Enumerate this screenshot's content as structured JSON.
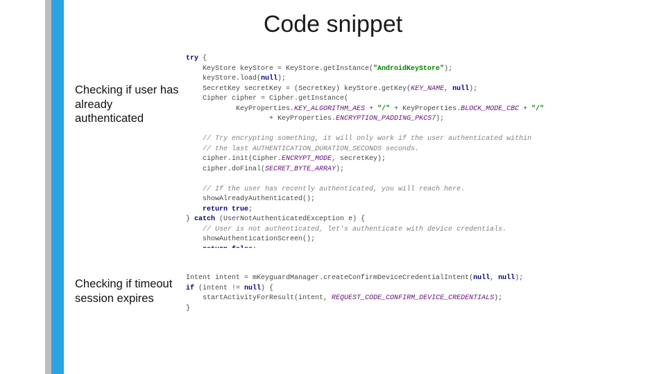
{
  "title": "Code snippet",
  "labels": {
    "auth": "Checking if user has already authenticated",
    "timeout": "Checking if timeout session expires"
  },
  "code1": {
    "l00a": "try",
    "l00b": " {",
    "l01a": "    KeyStore keyStore = KeyStore.getInstance(",
    "l01b": "\"AndroidKeyStore\"",
    "l01c": ");",
    "l02a": "    keyStore.load(",
    "l02b": "null",
    "l02c": ");",
    "l03a": "    SecretKey secretKey = (SecretKey) keyStore.getKey(",
    "l03b": "KEY_NAME",
    "l03c": ", ",
    "l03d": "null",
    "l03e": ");",
    "l04": "    Cipher cipher = Cipher.getInstance(",
    "l05a": "            KeyProperties.",
    "l05b": "KEY_ALGORITHM_AES",
    "l05c": " + ",
    "l05d": "\"/\"",
    "l05e": " + KeyProperties.",
    "l05f": "BLOCK_MODE_CBC",
    "l05g": " + ",
    "l05h": "\"/\"",
    "l06a": "                    + KeyProperties.",
    "l06b": "ENCRYPTION_PADDING_PKCS7",
    "l06c": ");",
    "l07": "",
    "l08": "    // Try encrypting something, it will only work if the user authenticated within",
    "l09": "    // the last AUTHENTICATION_DURATION_SECONDS seconds.",
    "l10a": "    cipher.init(Cipher.",
    "l10b": "ENCRYPT_MODE",
    "l10c": ", secretKey);",
    "l11a": "    cipher.doFinal(",
    "l11b": "SECRET_BYTE_ARRAY",
    "l11c": ");",
    "l12": "",
    "l13": "    // If the user has recently authenticated, you will reach here.",
    "l14": "    showAlreadyAuthenticated();",
    "l15a": "    ",
    "l15b": "return true",
    "l15c": ";",
    "l16a": "} ",
    "l16b": "catch",
    "l16c": " (UserNotAuthenticatedException e) {",
    "l17": "    // User is not authenticated, let's authenticate with device credentials.",
    "l18": "    showAuthenticationScreen();",
    "l19a": "    ",
    "l19b": "return false",
    "l19c": ";"
  },
  "code2": {
    "l00a": "Intent intent = mKeyguardManager.createConfirmDeviceCredentialIntent(",
    "l00b": "null",
    "l00c": ", ",
    "l00d": "null",
    "l00e": ");",
    "l01a": "if",
    "l01b": " (intent != ",
    "l01c": "null",
    "l01d": ") {",
    "l02a": "    startActivityForResult(intent, ",
    "l02b": "REQUEST_CODE_CONFIRM_DEVICE_CREDENTIALS",
    "l02c": ");",
    "l03": "}"
  }
}
